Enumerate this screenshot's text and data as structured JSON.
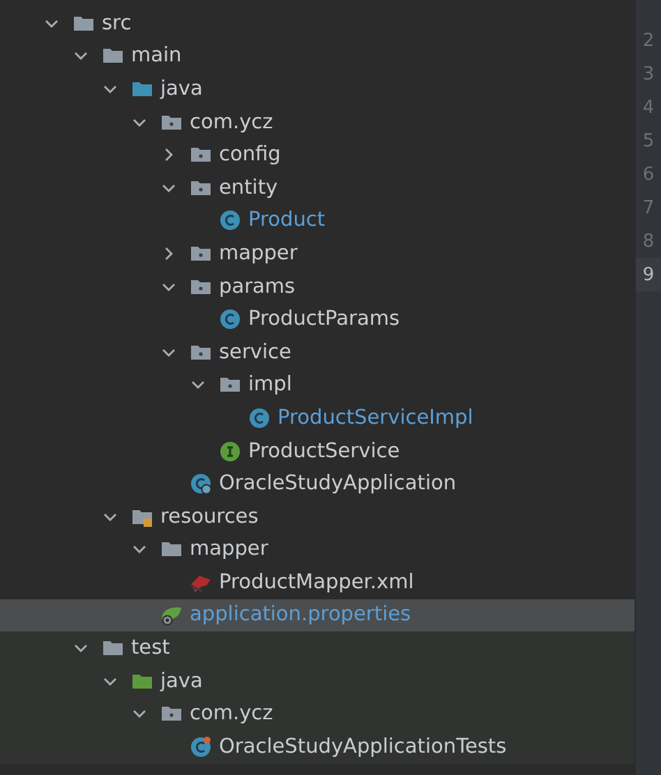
{
  "tree": [
    {
      "name": "src",
      "kind": "folder",
      "expanded": true,
      "selected": false,
      "children": [
        {
          "name": "main",
          "kind": "folder",
          "test_scope": false,
          "expanded": true,
          "selected": false,
          "children": [
            {
              "name": "java",
              "kind": "source_root",
              "expanded": true,
              "selected": false,
              "children": [
                {
                  "name": "com.ycz",
                  "kind": "package",
                  "expanded": true,
                  "selected": false,
                  "children": [
                    {
                      "name": "config",
                      "kind": "package",
                      "expanded": false,
                      "selected": false
                    },
                    {
                      "name": "entity",
                      "kind": "package",
                      "expanded": true,
                      "selected": false,
                      "children": [
                        {
                          "name": "Product",
                          "kind": "class",
                          "selected": false,
                          "color": "#5c9fd6"
                        }
                      ]
                    },
                    {
                      "name": "mapper",
                      "kind": "package",
                      "expanded": false,
                      "selected": false
                    },
                    {
                      "name": "params",
                      "kind": "package",
                      "expanded": true,
                      "selected": false,
                      "children": [
                        {
                          "name": "ProductParams",
                          "kind": "class",
                          "selected": false,
                          "color": "#c9ccd0"
                        }
                      ]
                    },
                    {
                      "name": "service",
                      "kind": "package",
                      "expanded": true,
                      "selected": false,
                      "children": [
                        {
                          "name": "impl",
                          "kind": "package",
                          "expanded": true,
                          "selected": false,
                          "children": [
                            {
                              "name": "ProductServiceImpl",
                              "kind": "class",
                              "selected": false,
                              "color": "#5c9fd6"
                            }
                          ]
                        },
                        {
                          "name": "ProductService",
                          "kind": "interface",
                          "selected": false,
                          "color": "#c9ccd0"
                        }
                      ]
                    },
                    {
                      "name": "OracleStudyApplication",
                      "kind": "spring_app",
                      "selected": false,
                      "color": "#c9ccd0"
                    }
                  ]
                }
              ]
            },
            {
              "name": "resources",
              "kind": "resources_root",
              "expanded": true,
              "selected": false,
              "children": [
                {
                  "name": "mapper",
                  "kind": "folder",
                  "expanded": true,
                  "selected": false,
                  "children": [
                    {
                      "name": "ProductMapper.xml",
                      "kind": "xml",
                      "selected": false,
                      "color": "#c9ccd0"
                    }
                  ]
                },
                {
                  "name": "application.properties",
                  "kind": "properties",
                  "selected": true,
                  "color": "#5c9fd6"
                }
              ]
            }
          ]
        },
        {
          "name": "test",
          "kind": "folder",
          "test_scope": true,
          "expanded": true,
          "selected": false,
          "children": [
            {
              "name": "java",
              "kind": "test_root",
              "expanded": true,
              "selected": false,
              "children": [
                {
                  "name": "com.ycz",
                  "kind": "package",
                  "expanded": true,
                  "selected": false,
                  "children": [
                    {
                      "name": "OracleStudyApplicationTests",
                      "kind": "spring_test",
                      "selected": false,
                      "color": "#c9ccd0"
                    }
                  ]
                }
              ]
            }
          ]
        }
      ]
    }
  ],
  "gutter": [
    {
      "number": "2",
      "selected": false
    },
    {
      "number": "3",
      "selected": false
    },
    {
      "number": "4",
      "selected": false
    },
    {
      "number": "5",
      "selected": false
    },
    {
      "number": "6",
      "selected": false
    },
    {
      "number": "7",
      "selected": false
    },
    {
      "number": "8",
      "selected": false
    },
    {
      "number": "9",
      "selected": true
    }
  ]
}
